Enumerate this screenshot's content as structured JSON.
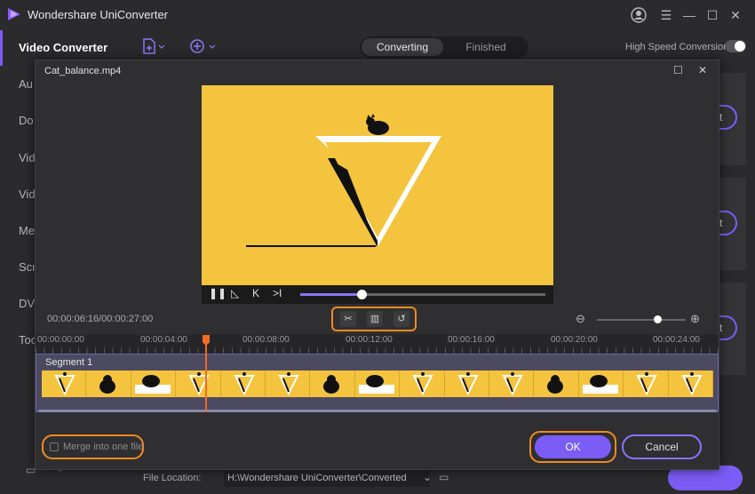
{
  "app": {
    "title": "Wondershare UniConverter"
  },
  "colors": {
    "accent": "#7b5cf5",
    "highlight": "#f08a24",
    "video_bg": "#f4c43e"
  },
  "sidebar": {
    "items": [
      {
        "label": "Video Converter",
        "active": true
      },
      {
        "label": "Au"
      },
      {
        "label": "Do"
      },
      {
        "label": "Vid"
      },
      {
        "label": "Vid"
      },
      {
        "label": "Me"
      },
      {
        "label": "Scr"
      },
      {
        "label": "DV"
      },
      {
        "label": "Too"
      }
    ]
  },
  "toolbar": {
    "tabs": [
      {
        "label": "Converting",
        "active": true
      },
      {
        "label": "Finished"
      }
    ],
    "high_speed_label": "High Speed Conversion"
  },
  "background": {
    "convert_label": "rt",
    "file_location_label": "File Location:",
    "file_location_value": "H:\\Wondershare UniConverter\\Converted"
  },
  "modal": {
    "title": "Cat_balance.mp4",
    "player": {
      "progress": 0.25
    },
    "time_readout": "00:00:06:16/00:00:27:00",
    "zoom_level": 0.68,
    "ruler_labels": [
      "00:00:00:00",
      "00:00:04:00",
      "00:00:08:00",
      "00:00:12:00",
      "00:00:16:00",
      "00:00:20:00",
      "00:00:24:00"
    ],
    "segment_label": "Segment 1",
    "merge_label": "Merge into one file",
    "ok_label": "OK",
    "cancel_label": "Cancel"
  }
}
